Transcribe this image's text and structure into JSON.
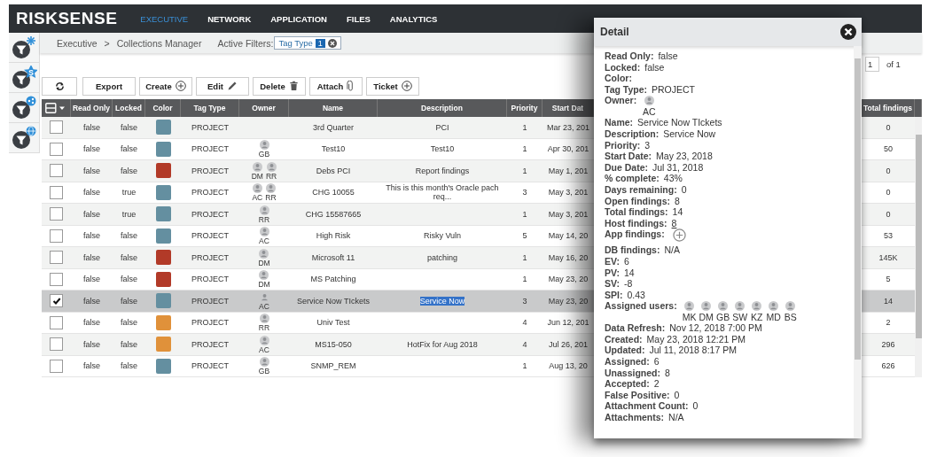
{
  "nav": {
    "logo": "RISKSENSE",
    "items": [
      {
        "label": "EXECUTIVE",
        "selected": true
      },
      {
        "label": "NETWORK",
        "selected": false
      },
      {
        "label": "APPLICATION",
        "selected": false
      },
      {
        "label": "FILES",
        "selected": false
      },
      {
        "label": "ANALYTICS",
        "selected": false
      }
    ]
  },
  "sidebar": {
    "items": [
      {
        "kind": "spark"
      },
      {
        "kind": "star",
        "badge": "S"
      },
      {
        "kind": "share"
      },
      {
        "kind": "globe"
      }
    ]
  },
  "breadcrumb": {
    "items": [
      "Executive",
      "Collections Manager"
    ],
    "separator": ">"
  },
  "filters": {
    "label": "Active Filters:",
    "chips": [
      {
        "label": "Tag Type",
        "count": "1"
      }
    ]
  },
  "pagination": {
    "page": "1",
    "total": "of 1"
  },
  "toolbar": {
    "buttons": [
      {
        "kind": "refresh"
      },
      {
        "kind": "text",
        "label": "Export"
      },
      {
        "kind": "plus",
        "label": "Create"
      },
      {
        "kind": "pencil",
        "label": "Edit"
      },
      {
        "kind": "trash",
        "label": "Delete"
      },
      {
        "kind": "clip",
        "label": "Attach"
      },
      {
        "kind": "plus",
        "label": "Ticket"
      }
    ]
  },
  "table": {
    "columns": [
      "Read Only",
      "Locked",
      "Color",
      "Tag Type",
      "Owner",
      "Name",
      "Description",
      "Priority",
      "Start Dat",
      "Total findings"
    ],
    "rows": [
      {
        "checked": false,
        "selected": false,
        "read_only": "false",
        "locked": "false",
        "color": "#648fa0",
        "tag_type": "PROJECT",
        "owners": [],
        "name": "3rd Quarter",
        "description": "PCI",
        "priority": "1",
        "start_date": "Mar 23, 201",
        "total_findings": "0"
      },
      {
        "checked": false,
        "selected": false,
        "read_only": "false",
        "locked": "false",
        "color": "#648fa0",
        "tag_type": "PROJECT",
        "owners": [
          "GB"
        ],
        "name": "Test10",
        "description": "Test10",
        "priority": "1",
        "start_date": "Apr 30, 201",
        "total_findings": "50"
      },
      {
        "checked": false,
        "selected": false,
        "read_only": "false",
        "locked": "false",
        "color": "#b23a28",
        "tag_type": "PROJECT",
        "owners": [
          "DM",
          "RR"
        ],
        "name": "Debs PCI",
        "description": "Report findings",
        "priority": "1",
        "start_date": "May 1, 201",
        "total_findings": "0"
      },
      {
        "checked": false,
        "selected": false,
        "read_only": "false",
        "locked": "true",
        "color": "#648fa0",
        "tag_type": "PROJECT",
        "owners": [
          "AC",
          "RR"
        ],
        "name": "CHG 10055",
        "description": "This is this month's Oracle pach req...",
        "priority": "3",
        "start_date": "May 3, 201",
        "total_findings": "0"
      },
      {
        "checked": false,
        "selected": false,
        "read_only": "false",
        "locked": "true",
        "color": "#648fa0",
        "tag_type": "PROJECT",
        "owners": [
          "RR"
        ],
        "name": "CHG 15587665",
        "priority": "1",
        "start_date": "May 3, 201",
        "total_findings": "0"
      },
      {
        "checked": false,
        "selected": false,
        "read_only": "false",
        "locked": "false",
        "color": "#648fa0",
        "tag_type": "PROJECT",
        "owners": [
          "AC"
        ],
        "name": "High Risk",
        "description": "Risky Vuln",
        "priority": "5",
        "start_date": "May 14, 20",
        "total_findings": "53"
      },
      {
        "checked": false,
        "selected": false,
        "read_only": "false",
        "locked": "false",
        "color": "#b23a28",
        "tag_type": "PROJECT",
        "owners": [
          "DM"
        ],
        "name": "Microsoft 11",
        "description": "patching",
        "priority": "1",
        "start_date": "May 16, 20",
        "total_findings": "145K"
      },
      {
        "checked": false,
        "selected": false,
        "read_only": "false",
        "locked": "false",
        "color": "#b23a28",
        "tag_type": "PROJECT",
        "owners": [
          "DM"
        ],
        "name": "MS Patching",
        "priority": "1",
        "start_date": "May 23, 20",
        "total_findings": "5"
      },
      {
        "checked": true,
        "selected": true,
        "read_only": "false",
        "locked": "false",
        "color": "#648fa0",
        "tag_type": "PROJECT",
        "owners": [
          "AC"
        ],
        "name": "Service Now TIckets",
        "description": "Service Now",
        "text_selected": true,
        "priority": "3",
        "start_date": "May 23, 20",
        "total_findings": "14"
      },
      {
        "checked": false,
        "selected": false,
        "read_only": "false",
        "locked": "false",
        "color": "#e0913a",
        "tag_type": "PROJECT",
        "owners": [
          "RR"
        ],
        "name": "Univ Test",
        "priority": "4",
        "start_date": "Jun 12, 201",
        "total_findings": "2"
      },
      {
        "checked": false,
        "selected": false,
        "read_only": "false",
        "locked": "false",
        "color": "#e0913a",
        "tag_type": "PROJECT",
        "owners": [
          "AC"
        ],
        "name": "MS15-050",
        "description": "HotFix for Aug 2018",
        "priority": "4",
        "start_date": "Jul 26, 201",
        "total_findings": "296"
      },
      {
        "checked": false,
        "selected": false,
        "read_only": "false",
        "locked": "false",
        "color": "#648fa0",
        "tag_type": "PROJECT",
        "owners": [
          "GB"
        ],
        "name": "SNMP_REM",
        "priority": "1",
        "start_date": "Aug 13, 20",
        "total_findings": "626"
      }
    ]
  },
  "detail": {
    "title": "Detail",
    "fields": [
      {
        "kind": "text",
        "label": "Read Only:",
        "value": "false"
      },
      {
        "kind": "text",
        "label": "Locked:",
        "value": "false"
      },
      {
        "kind": "text",
        "label": "Color:"
      },
      {
        "kind": "text",
        "label": "Tag Type:",
        "value": "PROJECT"
      },
      {
        "kind": "users",
        "label": "Owner:",
        "users": [
          "AC"
        ]
      },
      {
        "kind": "text",
        "label": "Name:",
        "value": "Service Now TIckets"
      },
      {
        "kind": "text",
        "label": "Description:",
        "value": "Service Now"
      },
      {
        "kind": "text",
        "label": "Priority:",
        "value": "3"
      },
      {
        "kind": "text",
        "label": "Start Date:",
        "value": "May 23, 2018"
      },
      {
        "kind": "text",
        "label": "Due Date:",
        "value": "Jul 31, 2018"
      },
      {
        "kind": "text",
        "label": "% complete:",
        "value": "43%"
      },
      {
        "kind": "text",
        "label": "Days remaining:",
        "value": "0"
      },
      {
        "kind": "text",
        "label": "Open findings:",
        "value": "8"
      },
      {
        "kind": "text",
        "label": "Total findings:",
        "value": "14"
      },
      {
        "kind": "link",
        "label": "Host findings:",
        "value": "8"
      },
      {
        "kind": "add",
        "label": "App findings:"
      },
      {
        "kind": "text",
        "label": "DB findings:",
        "value": "N/A"
      },
      {
        "kind": "text",
        "label": "EV:",
        "value": "6"
      },
      {
        "kind": "text",
        "label": "PV:",
        "value": "14"
      },
      {
        "kind": "text",
        "label": "SV:",
        "value": "-8"
      },
      {
        "kind": "text",
        "label": "SPI:",
        "value": "0.43"
      },
      {
        "kind": "users",
        "label": "Assigned users:",
        "users": [
          "MK",
          "DM",
          "GB",
          "SW",
          "KZ",
          "MD",
          "BS"
        ]
      },
      {
        "kind": "text",
        "label": "Data Refresh:",
        "value": "Nov 12, 2018 7:00 PM"
      },
      {
        "kind": "text",
        "label": "Created:",
        "value": "May 23, 2018 12:21 PM"
      },
      {
        "kind": "text",
        "label": "Updated:",
        "value": "Jul 11, 2018 8:17 PM"
      },
      {
        "kind": "text",
        "label": "Assigned:",
        "value": "6"
      },
      {
        "kind": "text",
        "label": "Unassigned:",
        "value": "8"
      },
      {
        "kind": "text",
        "label": "Accepted:",
        "value": "2"
      },
      {
        "kind": "text",
        "label": "False Positive:",
        "value": "0"
      },
      {
        "kind": "text",
        "label": "Attachment Count:",
        "value": "0"
      },
      {
        "kind": "text",
        "label": "Attachments:",
        "value": "N/A"
      }
    ]
  }
}
